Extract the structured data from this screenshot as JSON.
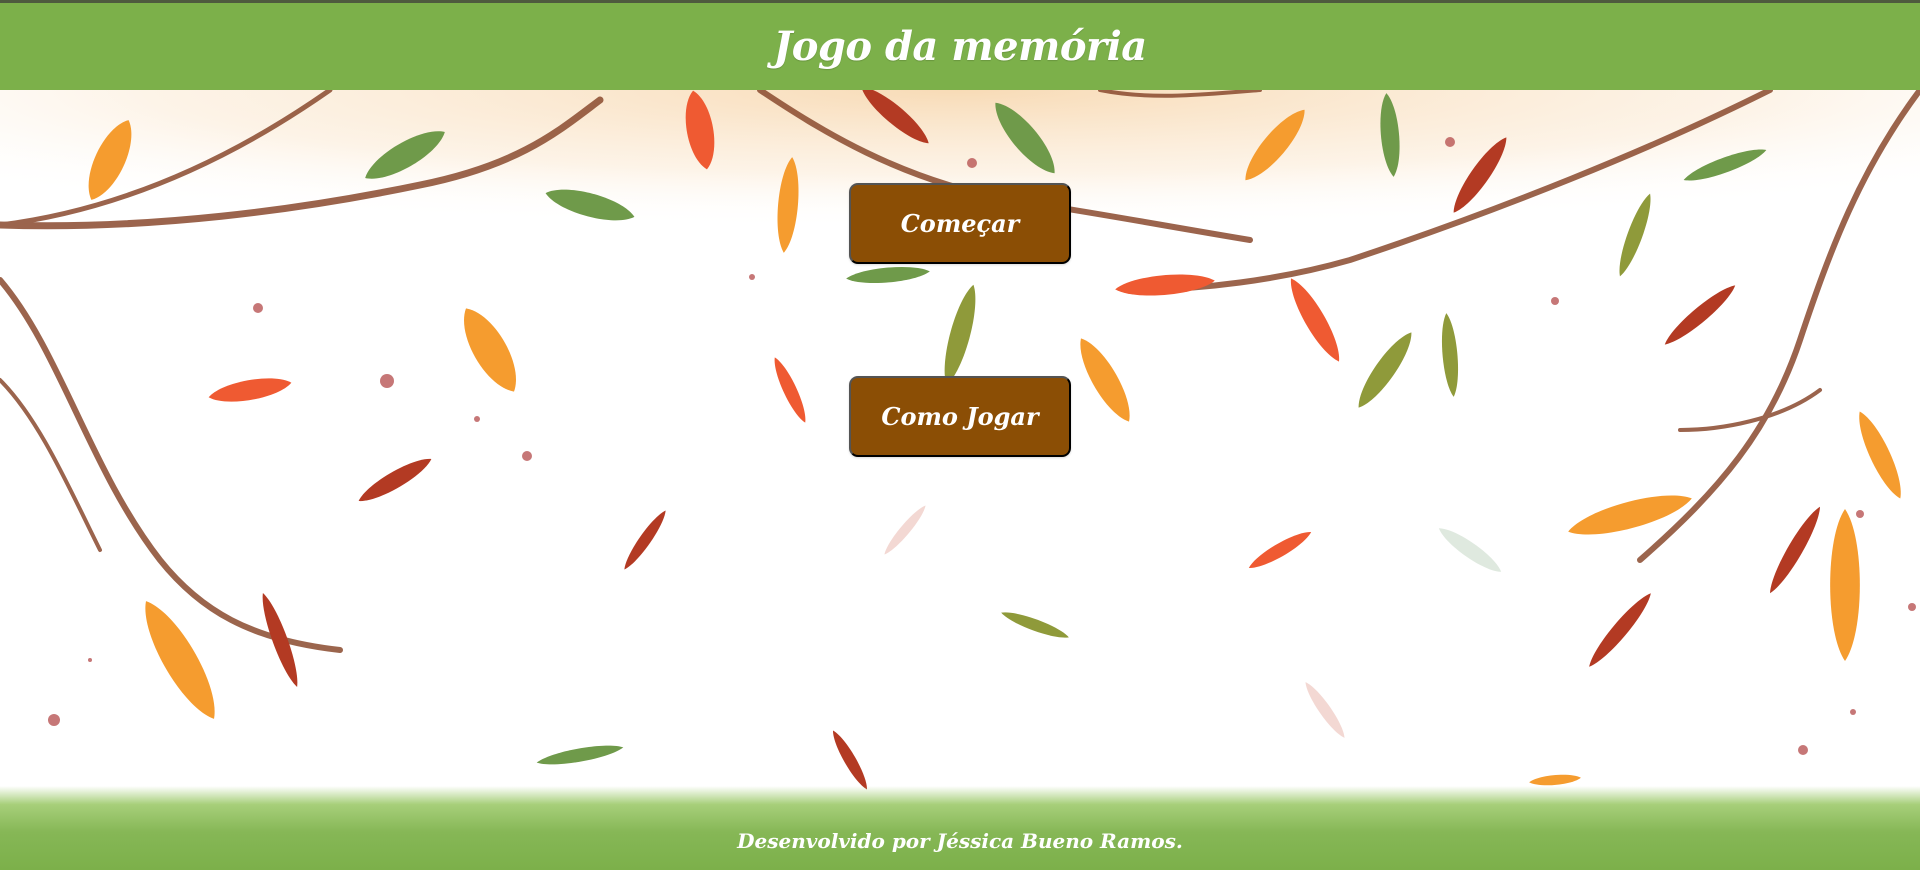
{
  "header": {
    "title": "Jogo da memória"
  },
  "menu": {
    "start_label": "Começar",
    "howto_label": "Como Jogar"
  },
  "footer": {
    "credit": "Desenvolvido por Jéssica Bueno Ramos."
  },
  "colors": {
    "header_bg": "#7cb04a",
    "button_bg": "#8b4e05",
    "text": "#ffffff"
  }
}
